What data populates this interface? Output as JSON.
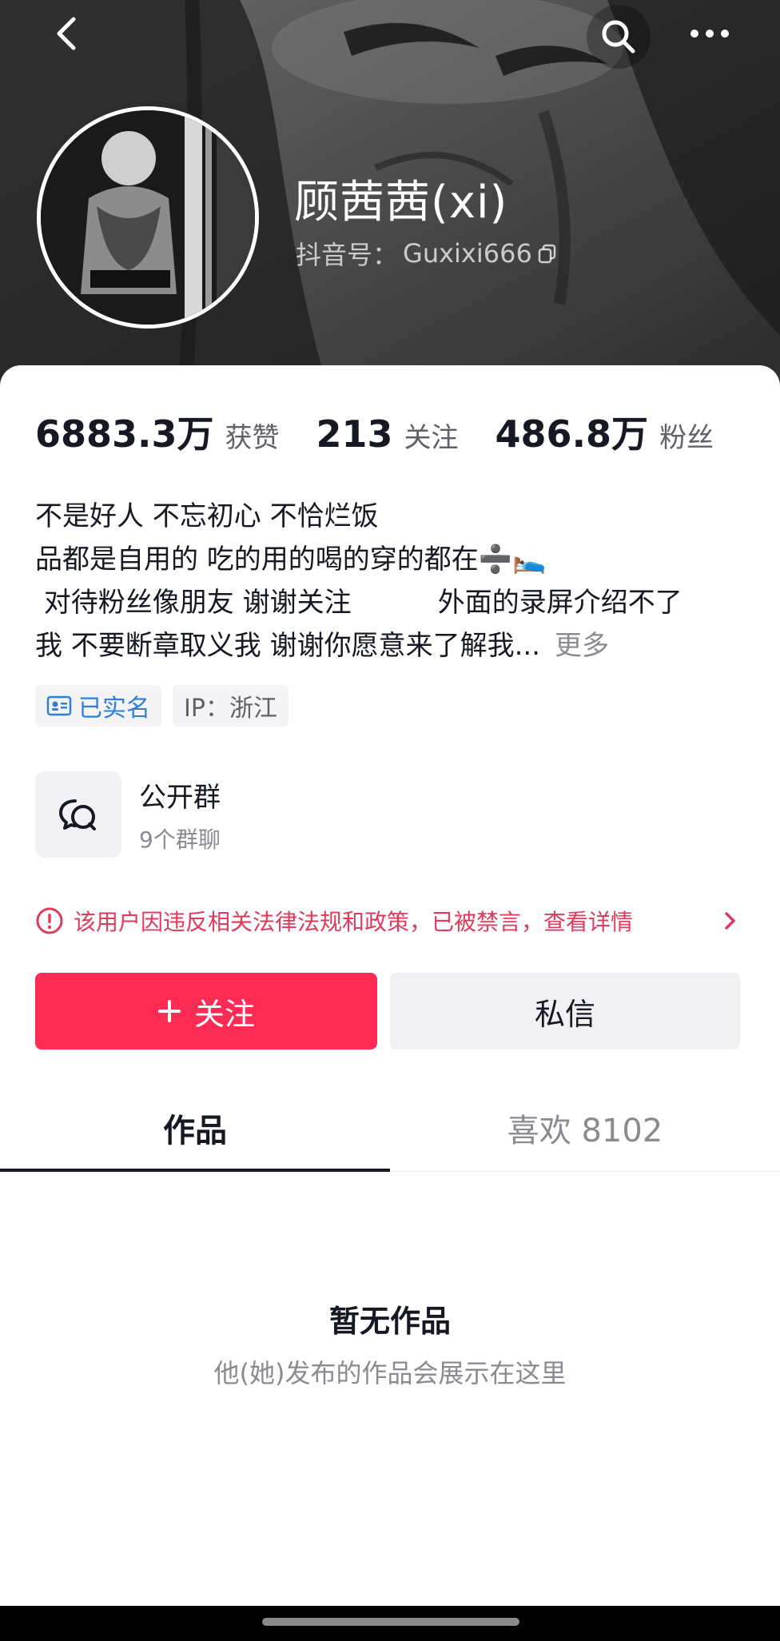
{
  "profile": {
    "username": "顾茜茜(xi)",
    "douyin_id_label": "抖音号：",
    "douyin_id": "Guxixi666"
  },
  "stats": [
    {
      "value": "6883.3万",
      "label": "获赞"
    },
    {
      "value": "213",
      "label": "关注"
    },
    {
      "value": "486.8万",
      "label": "粉丝"
    }
  ],
  "bio": {
    "line1": "不是好人 不忘初心 不恰烂饭",
    "line2": "品都是自用的 吃的用的喝的穿的都在➗🛌",
    "line3": " 对待粉丝像朋友 谢谢关注          外面的录屏介绍不了",
    "line4": "我 不要断章取义我 谢谢你愿意来了解我...",
    "more_label": "更多"
  },
  "tags": {
    "verified_label": "已实名",
    "ip_label": "IP：浙江"
  },
  "group": {
    "title": "公开群",
    "subtitle": "9个群聊"
  },
  "warning": {
    "text": "该用户因违反相关法律法规和政策，已被禁言，查看详情"
  },
  "buttons": {
    "follow_label": "关注",
    "message_label": "私信"
  },
  "tabs": [
    {
      "label": "作品",
      "active": true
    },
    {
      "label": "喜欢 8102",
      "active": false
    }
  ],
  "empty_state": {
    "title": "暂无作品",
    "subtitle": "他(她)发布的作品会展示在这里"
  },
  "colors": {
    "accent": "#fe2c55",
    "warning": "#e03a5c",
    "verified": "#2f7fd8"
  },
  "icons": [
    "back-icon",
    "search-icon",
    "more-icon",
    "copy-icon",
    "id-card-icon",
    "group-chat-icon",
    "warning-icon",
    "chevron-right-icon",
    "plus-icon"
  ]
}
